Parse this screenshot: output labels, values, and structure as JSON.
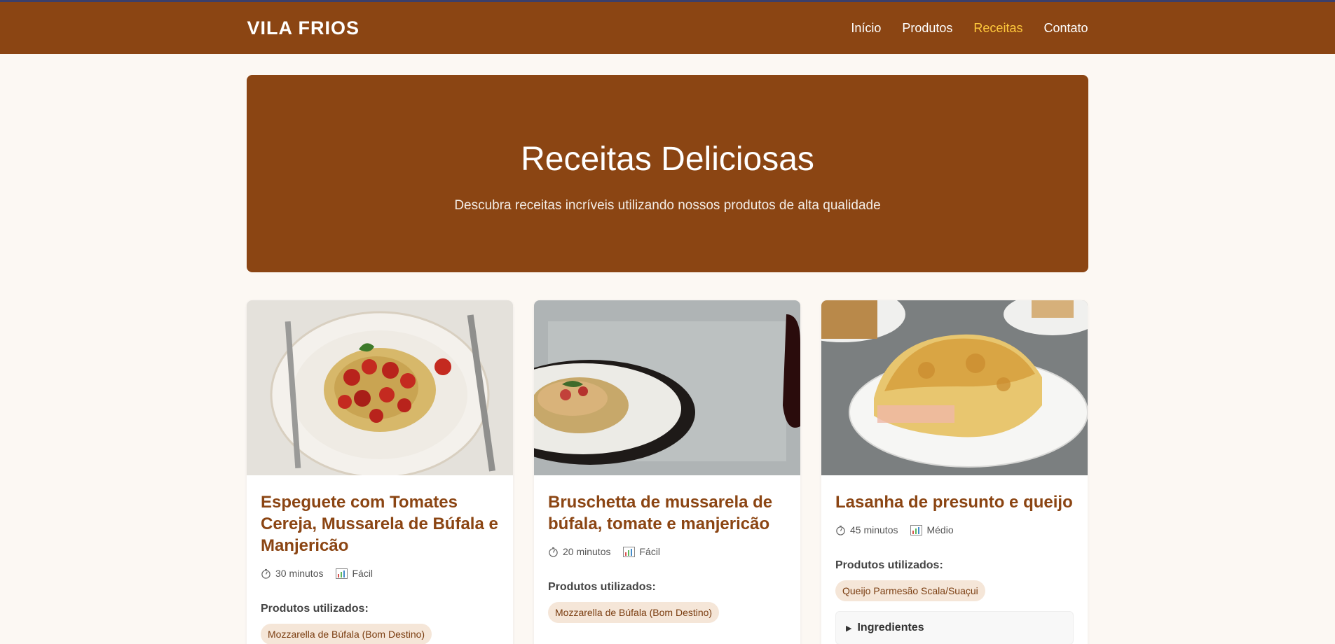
{
  "header": {
    "brand": "VILA FRIOS",
    "nav": [
      {
        "label": "Início"
      },
      {
        "label": "Produtos"
      },
      {
        "label": "Receitas",
        "active": true
      },
      {
        "label": "Contato"
      }
    ]
  },
  "hero": {
    "title": "Receitas Deliciosas",
    "subtitle": "Descubra receitas incríveis utilizando nossos produtos de alta qualidade"
  },
  "recipes": [
    {
      "title": "Espeguete com Tomates Cereja, Mussarela de Búfala e Manjericão",
      "time": "30 minutos",
      "difficulty": "Fácil",
      "products_label": "Produtos utilizados:",
      "products": [
        "Mozzarella de Búfala (Bom Destino)"
      ]
    },
    {
      "title": "Bruschetta de mussarela de búfala, tomate e manjericão",
      "time": "20 minutos",
      "difficulty": "Fácil",
      "products_label": "Produtos utilizados:",
      "products": [
        "Mozzarella de Búfala (Bom Destino)"
      ]
    },
    {
      "title": "Lasanha de presunto e queijo",
      "time": "45 minutos",
      "difficulty": "Médio",
      "products_label": "Produtos utilizados:",
      "products": [
        "Queijo Parmesão Scala/Suaçui"
      ],
      "details_label": "Ingredientes"
    }
  ],
  "colors": {
    "brand": "#8b4513",
    "active_nav": "#ffc93c",
    "background": "#fcf8f3"
  }
}
